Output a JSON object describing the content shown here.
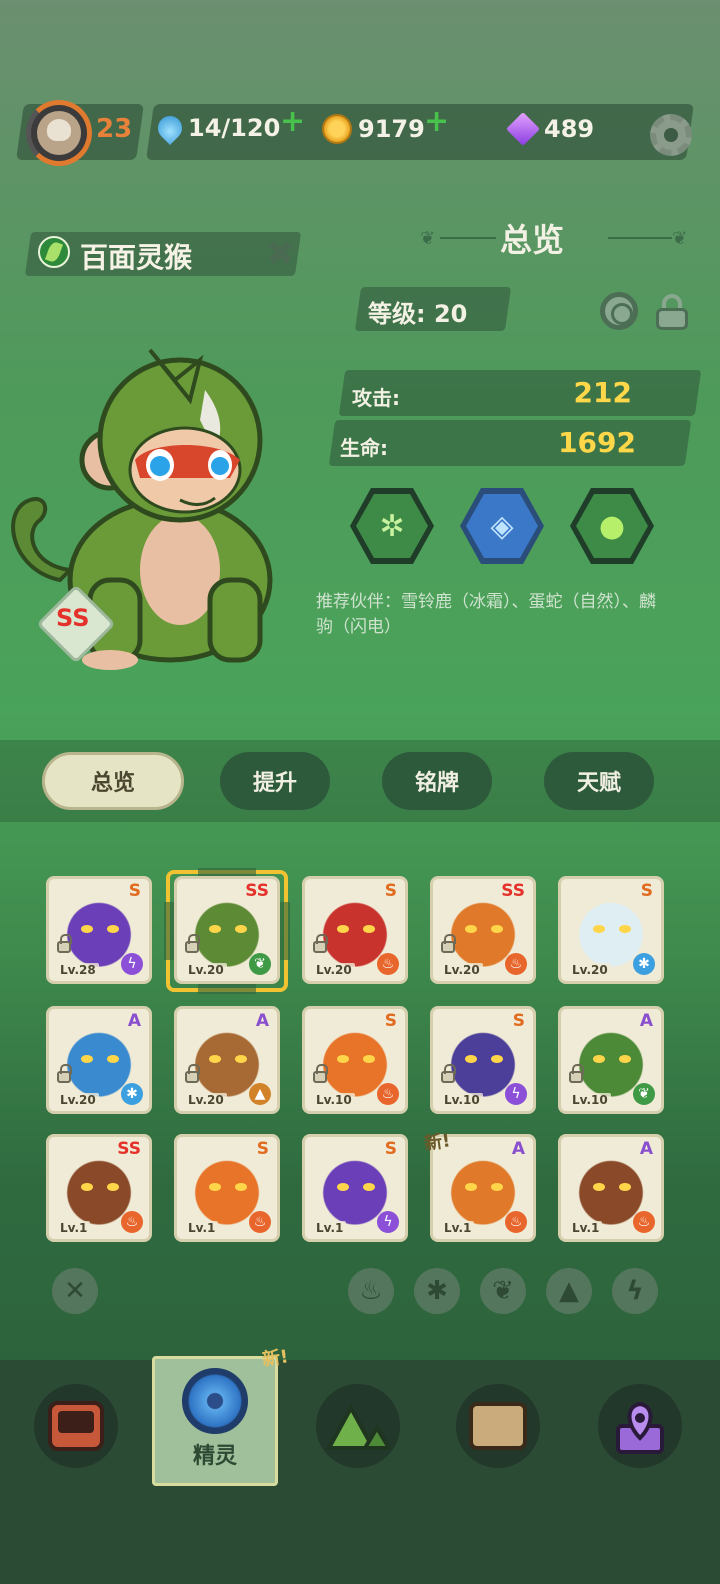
{
  "topbar": {
    "player_level": "23",
    "energy": "14/120",
    "energy_plus": "+",
    "coins": "9179",
    "coins_plus": "+",
    "gems": "489"
  },
  "monster": {
    "name": "百面灵猴",
    "rank": "SS"
  },
  "overview": {
    "title": "总览",
    "grade_label": "等级: 20",
    "attack_label": "攻击:",
    "attack_value": "212",
    "hp_label": "生命:",
    "hp_value": "1692",
    "partner_text": "推荐伙伴：雪铃鹿（冰霜）、蛋蛇（自然）、麟驹（闪电）"
  },
  "tabs": [
    "总览",
    "提升",
    "铭牌",
    "天赋"
  ],
  "cards": [
    {
      "rank": "S",
      "level": "Lv.28",
      "element": "lightning",
      "locked": true
    },
    {
      "rank": "SS",
      "level": "Lv.20",
      "element": "nature",
      "locked": true,
      "selected": true
    },
    {
      "rank": "S",
      "level": "Lv.20",
      "element": "fire",
      "locked": true
    },
    {
      "rank": "SS",
      "level": "Lv.20",
      "element": "fire",
      "locked": true
    },
    {
      "rank": "S",
      "level": "Lv.20",
      "element": "ice",
      "locked": false
    },
    {
      "rank": "A",
      "level": "Lv.20",
      "element": "ice",
      "locked": true
    },
    {
      "rank": "A",
      "level": "Lv.20",
      "element": "earth",
      "locked": true
    },
    {
      "rank": "S",
      "level": "Lv.10",
      "element": "fire",
      "locked": true
    },
    {
      "rank": "S",
      "level": "Lv.10",
      "element": "lightning",
      "locked": true
    },
    {
      "rank": "A",
      "level": "Lv.10",
      "element": "nature",
      "locked": true
    },
    {
      "rank": "SS",
      "level": "Lv.1",
      "element": "fire",
      "locked": false
    },
    {
      "rank": "S",
      "level": "Lv.1",
      "element": "fire",
      "locked": false
    },
    {
      "rank": "S",
      "level": "Lv.1",
      "element": "lightning",
      "locked": false
    },
    {
      "rank": "A",
      "level": "Lv.1",
      "element": "fire",
      "locked": false,
      "new": "新!"
    },
    {
      "rank": "A",
      "level": "Lv.1",
      "element": "fire",
      "locked": false
    }
  ],
  "filters": {
    "clear": "✕",
    "items": [
      "fire-icon",
      "ice-icon",
      "nature-icon",
      "earth-icon",
      "lightning-icon"
    ]
  },
  "bottom_nav": {
    "active_label": "精灵",
    "new_tag": "新!"
  },
  "colors": {
    "fire": "#e8652c",
    "ice": "#3c9fe0",
    "nature": "#3f9a45",
    "earth": "#d2832a",
    "lightning": "#8b4fd8",
    "rank_ss": "#e4312b",
    "rank_s": "#e06a1e",
    "rank_a": "#8a4fd0"
  }
}
